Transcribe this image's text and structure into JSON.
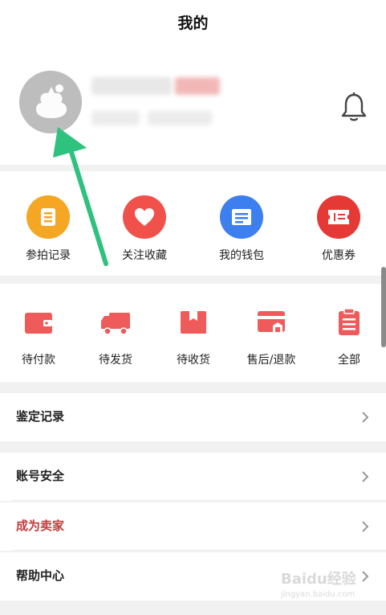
{
  "header": {
    "title": "我的"
  },
  "quick_actions": [
    {
      "label": "参拍记录",
      "icon": "list-icon",
      "color": "#f5a623"
    },
    {
      "label": "关注收藏",
      "icon": "heart-icon",
      "color": "#f0524b"
    },
    {
      "label": "我的钱包",
      "icon": "wallet-icon",
      "color": "#3e7ff0"
    },
    {
      "label": "优惠券",
      "icon": "ticket-icon",
      "color": "#e53935"
    }
  ],
  "orders": [
    {
      "label": "待付款",
      "icon": "wallet-icon"
    },
    {
      "label": "待发货",
      "icon": "truck-icon"
    },
    {
      "label": "待收货",
      "icon": "package-icon"
    },
    {
      "label": "售后/退款",
      "icon": "refund-icon"
    },
    {
      "label": "全部",
      "icon": "clipboard-icon"
    }
  ],
  "menu": {
    "appraisal": "鉴定记录",
    "account_security": "账号安全",
    "become_seller": "成为卖家",
    "help_center": "帮助中心"
  },
  "watermark": {
    "brand": "Baidu经验",
    "url": "jingyan.baidu.com"
  },
  "colors": {
    "accent_red": "#ef5b5b",
    "arrow_green": "#2ec27e",
    "seller_red": "#c23a3a"
  }
}
